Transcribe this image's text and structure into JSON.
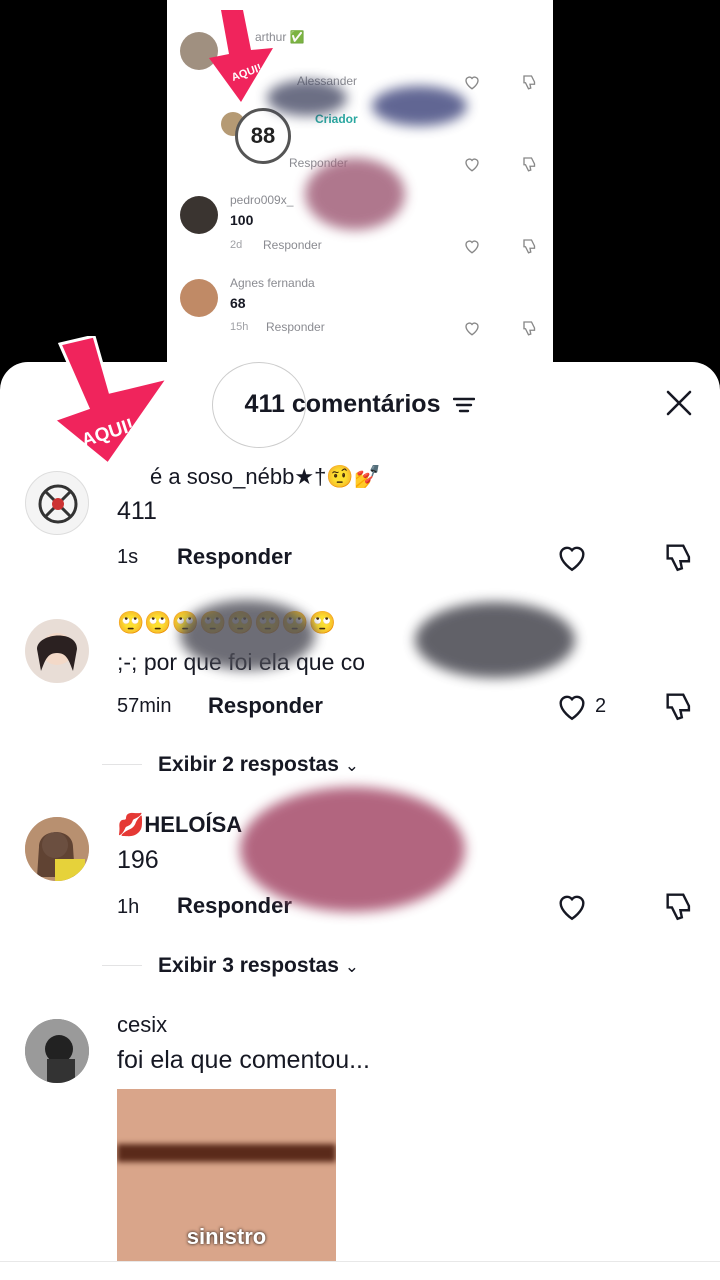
{
  "background_post": {
    "comments": [
      {
        "name": "arthur ✅",
        "text": "",
        "time": "",
        "reply": ""
      },
      {
        "name": "Alessander",
        "creator_tag": "Criador",
        "text": "",
        "time": "",
        "reply": "Responder"
      },
      {
        "name": "pedro009x_",
        "text": "100",
        "time": "2d",
        "reply": "Responder"
      },
      {
        "name": "Agnes fernanda",
        "text": "68",
        "time": "15h",
        "reply": "Responder"
      }
    ],
    "circled_number": "88",
    "arrow_label": "AQUI!"
  },
  "sheet": {
    "title": "411 comentários",
    "arrow_label": "AQUI!",
    "comments": [
      {
        "name": "é a soso_nébb★†🤨💅",
        "text": "411",
        "time": "1s",
        "reply": "Responder",
        "likes": ""
      },
      {
        "name": "🙄🙄🙄🙄🙄🙄🙄🙄",
        "text": ";-; por que foi ela que co",
        "time": "57min",
        "reply": "Responder",
        "likes": "2",
        "view_replies": "Exibir 2 respostas"
      },
      {
        "name": "💋HELOÍSA",
        "text": "196",
        "time": "1h",
        "reply": "Responder",
        "likes": "",
        "view_replies": "Exibir 3 respostas"
      },
      {
        "name": "cesix",
        "text": "foi ela que comentou...",
        "sticker_caption": "sinistro"
      }
    ]
  },
  "colors": {
    "accent_pink": "#f0245c",
    "sheet_bg": "#ffffff",
    "overlay": "#000000"
  }
}
